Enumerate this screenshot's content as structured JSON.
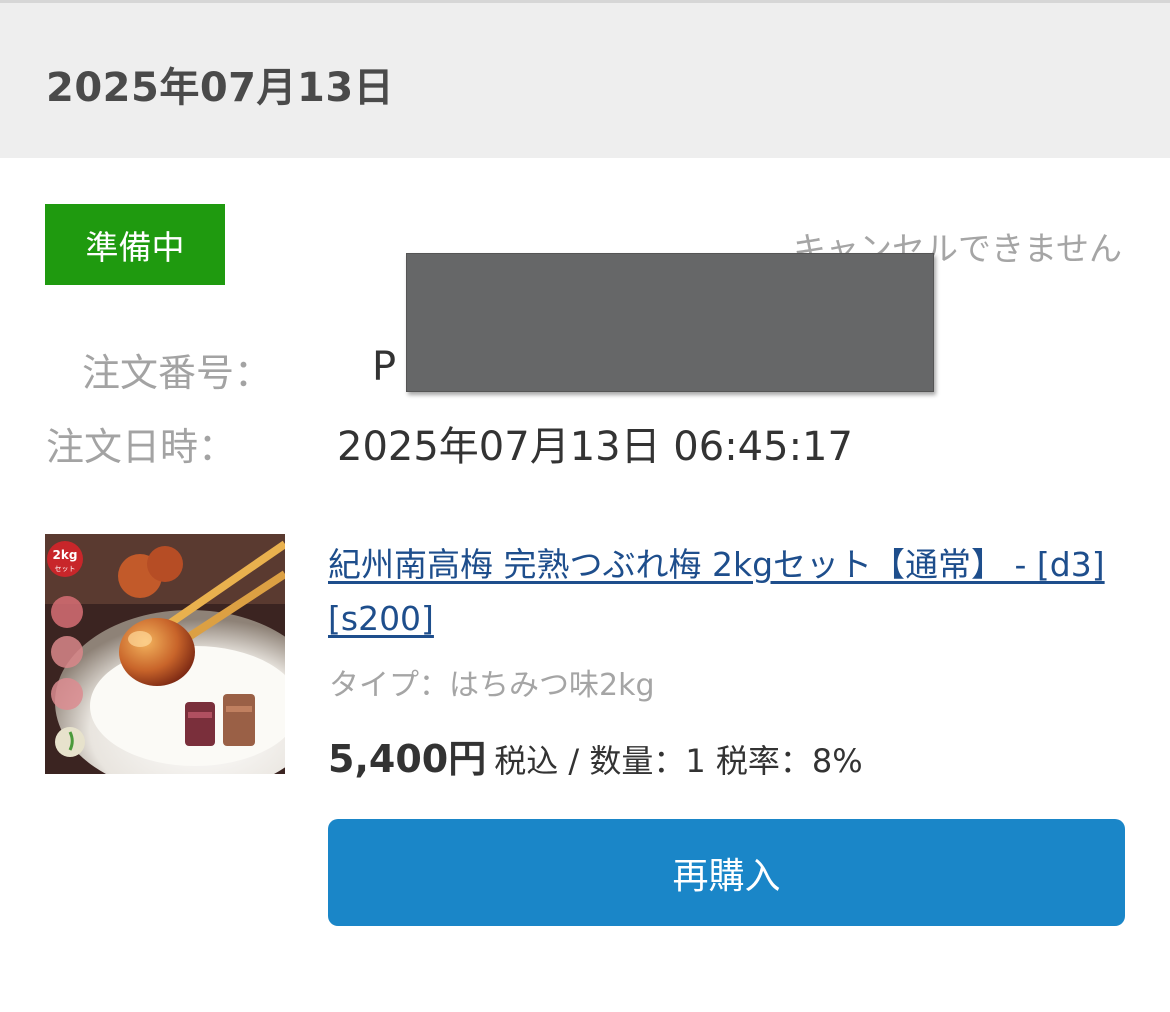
{
  "header": {
    "date": "2025年07月13日"
  },
  "order": {
    "status": "準備中",
    "status_color": "#1f9a0f",
    "cancel_note": "キャンセルできません",
    "number_label": "注文番号：",
    "number_value": "P",
    "date_label": "注文日時：",
    "date_value": "2025年07月13日 06:45:17"
  },
  "product": {
    "title": "紀州南高梅 完熟つぶれ梅 2kgセット【通常】 - [d3][s200]",
    "type": "タイプ：はちみつ味2kg",
    "price": "5,400円",
    "price_meta": "税込 / 数量：1 税率：8%",
    "image": {
      "badge_top": "2kg",
      "badge_bottom": "セット"
    }
  },
  "actions": {
    "rebuy_label": "再購入",
    "rebuy_color": "#1a86c8"
  },
  "icons": [
    "product-thumbnail-image",
    "redaction-box"
  ]
}
